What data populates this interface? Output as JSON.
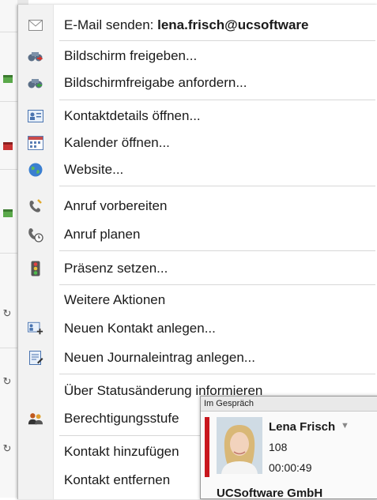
{
  "menu": {
    "items": [
      {
        "name": "menu-item-send-email",
        "icon": "envelope-icon",
        "label": "E-Mail senden: ",
        "label_bold": "lena.frisch@ucsoftware"
      },
      {
        "name": "menu-item-share-screen",
        "icon": "binoculars-share-icon",
        "label": "Bildschirm freigeben..."
      },
      {
        "name": "menu-item-request-screen-share",
        "icon": "binoculars-request-icon",
        "label": "Bildschirmfreigabe anfordern..."
      },
      {
        "name": "menu-item-open-contact-details",
        "icon": "contact-card-icon",
        "label": "Kontaktdetails öffnen..."
      },
      {
        "name": "menu-item-open-calendar",
        "icon": "calendar-icon",
        "label": "Kalender öffnen..."
      },
      {
        "name": "menu-item-website",
        "icon": "globe-icon",
        "label": "Website..."
      },
      {
        "name": "menu-item-prepare-call",
        "icon": "phone-prepare-icon",
        "label": "Anruf vorbereiten"
      },
      {
        "name": "menu-item-schedule-call",
        "icon": "phone-clock-icon",
        "label": "Anruf planen"
      },
      {
        "name": "menu-item-set-presence",
        "icon": "traffic-light-icon",
        "label": "Präsenz setzen..."
      },
      {
        "name": "menu-item-more-actions",
        "icon": "",
        "label": "Weitere Aktionen"
      },
      {
        "name": "menu-item-new-contact",
        "icon": "new-contact-icon",
        "label": "Neuen Kontakt anlegen..."
      },
      {
        "name": "menu-item-new-journal-entry",
        "icon": "journal-entry-icon",
        "label": "Neuen Journaleintrag anlegen..."
      },
      {
        "name": "menu-item-status-notify",
        "icon": "",
        "label": "Über Statusänderung informieren"
      },
      {
        "name": "menu-item-permission-level",
        "icon": "people-icon",
        "label": "Berechtigungsstufe"
      },
      {
        "name": "menu-item-add-contact",
        "icon": "",
        "label": "Kontakt hinzufügen"
      },
      {
        "name": "menu-item-remove-contact",
        "icon": "",
        "label": "Kontakt entfernen"
      }
    ]
  },
  "call_popup": {
    "header": "Im Gespräch",
    "name": "Lena Frisch",
    "extension": "108",
    "duration": "00:00:49",
    "company": "UCSoftware GmbH",
    "status_color": "#c8161d"
  },
  "colors": {
    "menu_bg": "#ffffff",
    "gutter_bg": "#f2f2f2",
    "separator": "#d7d7d7"
  }
}
